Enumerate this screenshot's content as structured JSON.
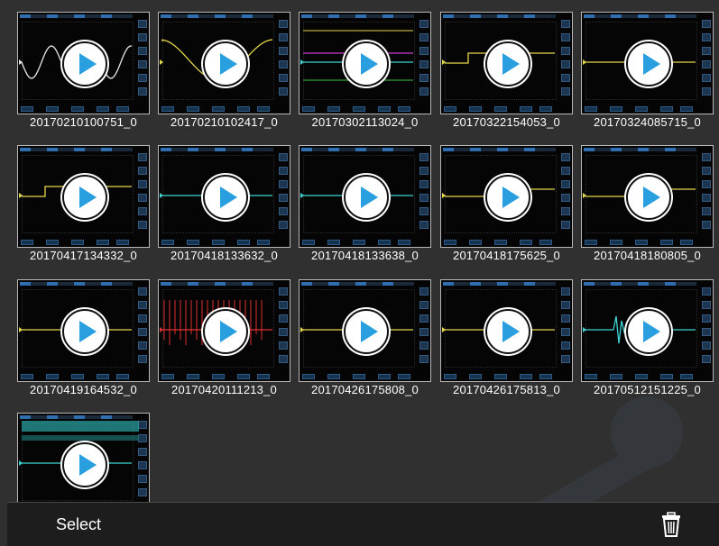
{
  "gallery": {
    "items": [
      {
        "label": "20170210100751_0",
        "trace_color": "#e7e7e7",
        "variant": "sine"
      },
      {
        "label": "20170210102417_0",
        "trace_color": "#e6d84a",
        "variant": "wave-yellow"
      },
      {
        "label": "20170302113024_0",
        "trace_color": "#3fd3d3",
        "variant": "multi"
      },
      {
        "label": "20170322154053_0",
        "trace_color": "#e6d84a",
        "variant": "square"
      },
      {
        "label": "20170324085715_0",
        "trace_color": "#e6d84a",
        "variant": "flat"
      },
      {
        "label": "20170417134332_0",
        "trace_color": "#e6d84a",
        "variant": "square"
      },
      {
        "label": "20170418133632_0",
        "trace_color": "#3fd3d3",
        "variant": "cyan-flat"
      },
      {
        "label": "20170418133638_0",
        "trace_color": "#3fd3d3",
        "variant": "cyan-flat"
      },
      {
        "label": "20170418175625_0",
        "trace_color": "#e6d84a",
        "variant": "step"
      },
      {
        "label": "20170418180805_0",
        "trace_color": "#e6d84a",
        "variant": "step"
      },
      {
        "label": "20170419164532_0",
        "trace_color": "#e6d84a",
        "variant": "flat"
      },
      {
        "label": "20170420111213_0",
        "trace_color": "#e03030",
        "variant": "red"
      },
      {
        "label": "20170426175808_0",
        "trace_color": "#e6d84a",
        "variant": "flat"
      },
      {
        "label": "20170426175813_0",
        "trace_color": "#e6d84a",
        "variant": "flat"
      },
      {
        "label": "20170512151225_0",
        "trace_color": "#3fd3d3",
        "variant": "pulse"
      },
      {
        "label": "",
        "trace_color": "#3fd3d3",
        "variant": "busy"
      }
    ]
  },
  "toolbar": {
    "select_label": "Select",
    "delete_icon": "trash-icon"
  },
  "colors": {
    "background": "#303030",
    "toolbar": "#1d1d1d",
    "play_accent": "#2a9fe0"
  }
}
